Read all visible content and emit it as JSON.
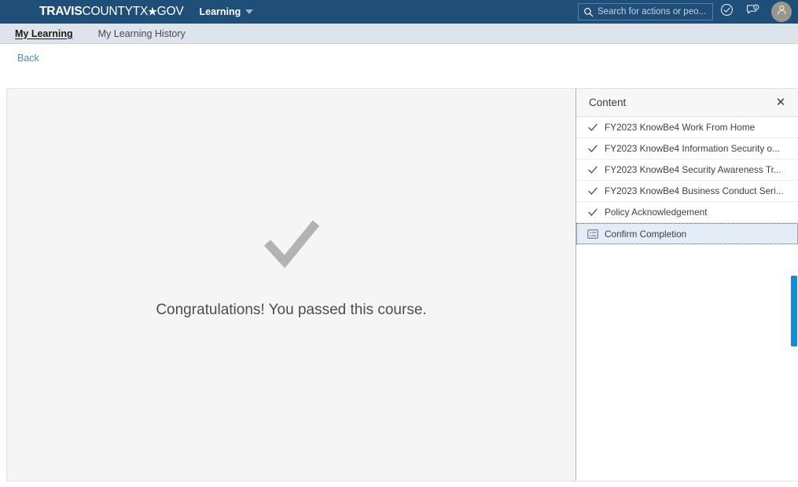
{
  "header": {
    "brand": {
      "travis": "TRAVIS",
      "county": "COUNTYTX",
      "star": "★",
      "gov": "GOV"
    },
    "app_menu_label": "Learning",
    "search": {
      "placeholder": "Search for actions or peo...",
      "value": "",
      "icon": "search-icon"
    },
    "todo_icon": "check-circle-icon",
    "notifications_icon": "notification-bubble-icon",
    "avatar_icon": "user-avatar-icon",
    "bar_color": "#1f4e79"
  },
  "subnav": {
    "items": [
      {
        "label": "My Learning",
        "active": true
      },
      {
        "label": "My Learning History",
        "active": false
      }
    ],
    "background_color": "#dde4ec"
  },
  "back_link": {
    "label": "Back",
    "color": "#4a90c4"
  },
  "stage": {
    "status_icon": "large-checkmark-icon",
    "status_icon_color": "#b3b3b3",
    "message": "Congratulations! You passed this course.",
    "background_color": "#f5f5f5"
  },
  "content_panel": {
    "title": "Content",
    "close_label": "✕",
    "selection_color": "#e3ecf7",
    "items": [
      {
        "label": "FY2023 KnowBe4 Work From Home",
        "icon": "checkmark-icon",
        "completed": true,
        "selected": false
      },
      {
        "label": "FY2023 KnowBe4 Information Security o...",
        "icon": "checkmark-icon",
        "completed": true,
        "selected": false
      },
      {
        "label": "FY2023 KnowBe4 Security Awareness Tr...",
        "icon": "checkmark-icon",
        "completed": true,
        "selected": false
      },
      {
        "label": "FY2023 KnowBe4 Business Conduct Seri...",
        "icon": "checkmark-icon",
        "completed": true,
        "selected": false
      },
      {
        "label": "Policy Acknowledgement",
        "icon": "checkmark-icon",
        "completed": true,
        "selected": false
      },
      {
        "label": "Confirm Completion",
        "icon": "form-list-icon",
        "completed": false,
        "selected": true
      }
    ]
  },
  "scrollbar": {
    "thumb_color": "#1a8ad4",
    "name": "page-scrollbar"
  }
}
